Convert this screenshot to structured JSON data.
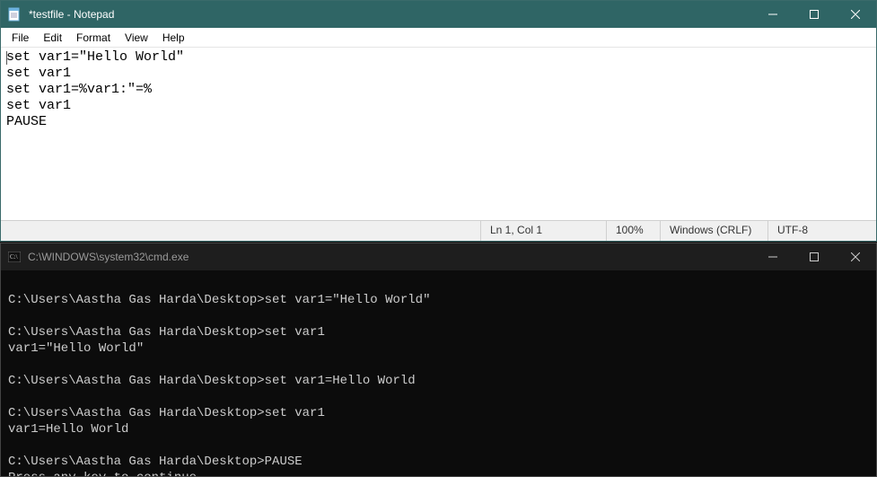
{
  "notepad": {
    "title": "*testfile - Notepad",
    "menu": {
      "file": "File",
      "edit": "Edit",
      "format": "Format",
      "view": "View",
      "help": "Help"
    },
    "editor_text": "set var1=\"Hello World\"\nset var1\nset var1=%var1:\"=%\nset var1\nPAUSE",
    "status": {
      "position": "Ln 1, Col 1",
      "zoom": "100%",
      "eol": "Windows (CRLF)",
      "encoding": "UTF-8"
    }
  },
  "cmd": {
    "title": "C:\\WINDOWS\\system32\\cmd.exe",
    "output": "\nC:\\Users\\Aastha Gas Harda\\Desktop>set var1=\"Hello World\"\n\nC:\\Users\\Aastha Gas Harda\\Desktop>set var1\nvar1=\"Hello World\"\n\nC:\\Users\\Aastha Gas Harda\\Desktop>set var1=Hello World\n\nC:\\Users\\Aastha Gas Harda\\Desktop>set var1\nvar1=Hello World\n\nC:\\Users\\Aastha Gas Harda\\Desktop>PAUSE\nPress any key to continue . . ."
  }
}
